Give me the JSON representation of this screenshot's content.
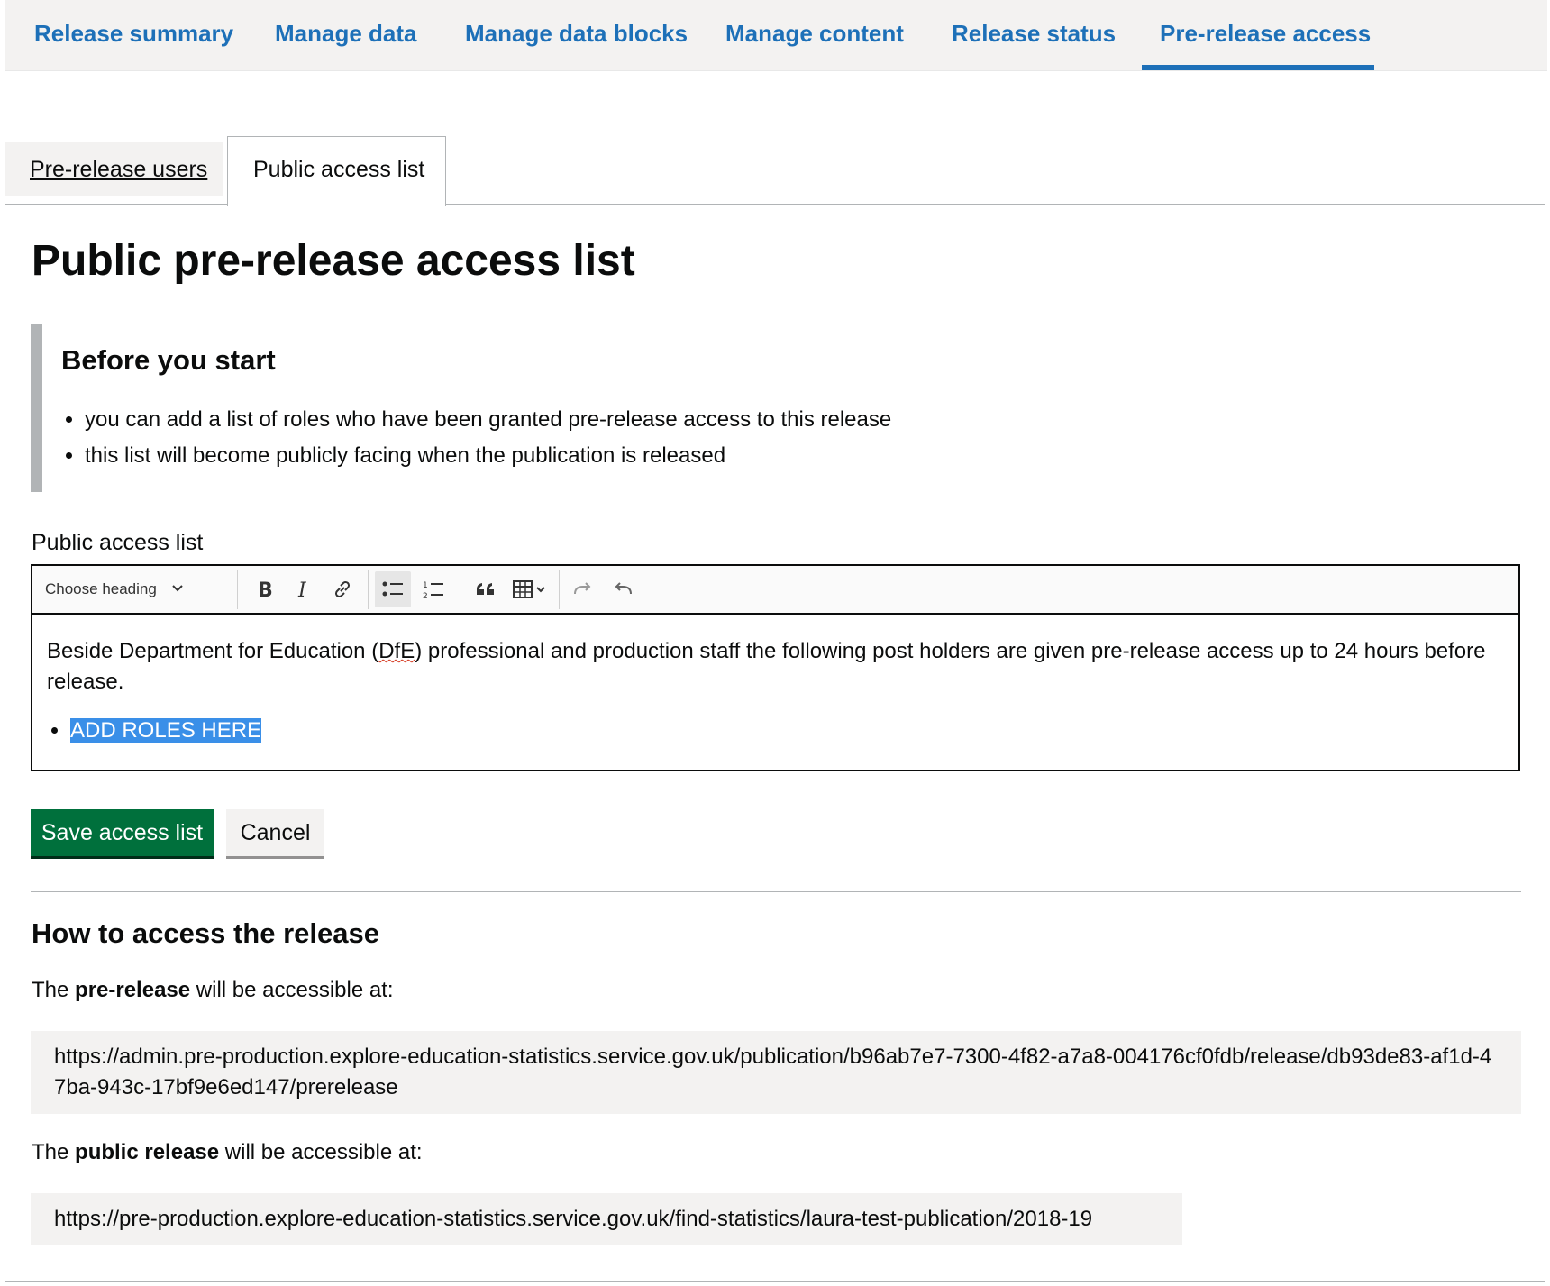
{
  "topnav": {
    "items": [
      {
        "label": "Release summary"
      },
      {
        "label": "Manage data"
      },
      {
        "label": "Manage data blocks"
      },
      {
        "label": "Manage content"
      },
      {
        "label": "Release status"
      },
      {
        "label": "Pre-release access",
        "active": true
      }
    ]
  },
  "tabs": [
    {
      "label": "Pre-release users",
      "selected": false
    },
    {
      "label": "Public access list",
      "selected": true
    }
  ],
  "page_title": "Public pre-release access list",
  "inset": {
    "heading": "Before you start",
    "items": [
      "you can add a list of roles who have been granted pre-release access to this release",
      "this list will become publicly facing when the publication is released"
    ]
  },
  "editor": {
    "label": "Public access list",
    "heading_select": "Choose heading",
    "toolbar_icons": [
      "bold-icon",
      "italic-icon",
      "link-icon",
      "bulleted-list-icon",
      "numbered-list-icon",
      "blockquote-icon",
      "table-icon",
      "redo-icon",
      "undo-icon"
    ],
    "content_before": "Beside Department for Education (",
    "content_dfe": "DfE",
    "content_after": ") professional and production staff the following post holders are given pre-release access up to 24 hours before release.",
    "list_items": [
      "ADD ROLES HERE"
    ]
  },
  "buttons": {
    "save": "Save access list",
    "cancel": "Cancel"
  },
  "access": {
    "heading": "How to access the release",
    "prerelease_prefix": "The ",
    "prerelease_bold": "pre-release",
    "prerelease_suffix": " will be accessible at:",
    "prerelease_url": "https://admin.pre-production.explore-education-statistics.service.gov.uk/publication/b96ab7e7-7300-4f82-a7a8-004176cf0fdb/release/db93de83-af1d-47ba-943c-17bf9e6ed147/prerelease",
    "public_prefix": "The ",
    "public_bold": "public release",
    "public_suffix": " will be accessible at:",
    "public_url": "https://pre-production.explore-education-statistics.service.gov.uk/find-statistics/laura-test-publication/2018-19"
  },
  "colors": {
    "link_blue": "#1d70b8",
    "save_green": "#00703c",
    "selection_blue": "#3a8fe8"
  }
}
